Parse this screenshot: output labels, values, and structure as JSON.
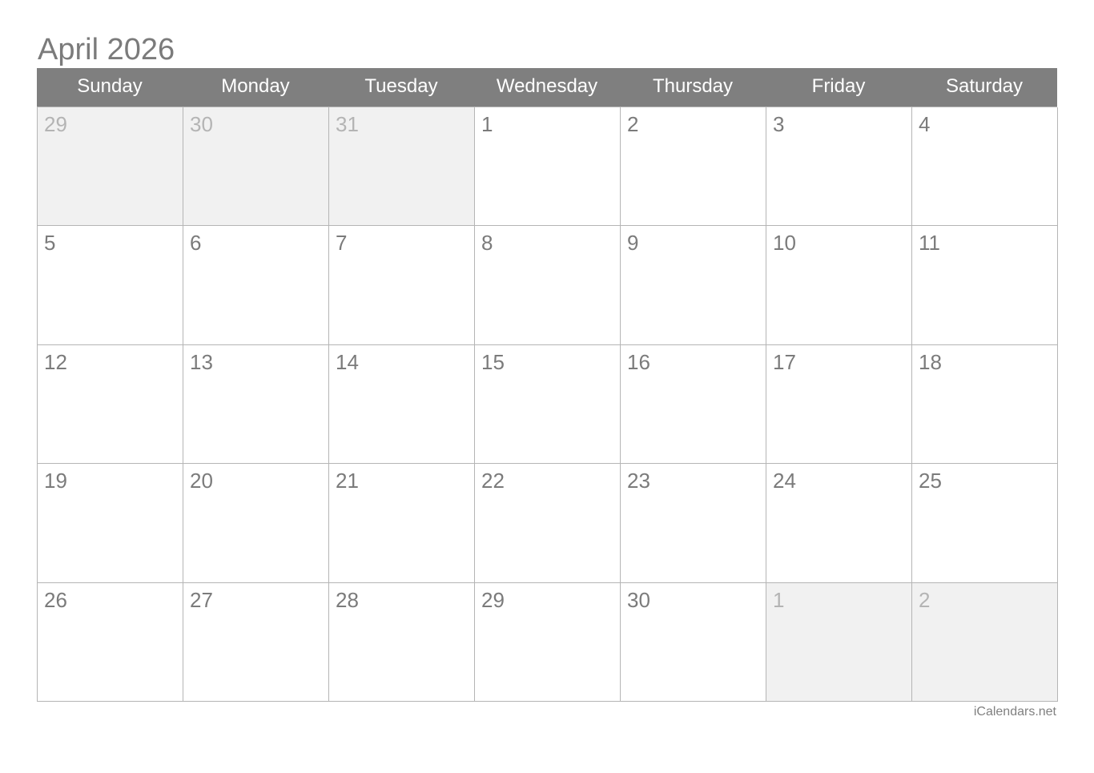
{
  "title": "April 2026",
  "weekdays": [
    "Sunday",
    "Monday",
    "Tuesday",
    "Wednesday",
    "Thursday",
    "Friday",
    "Saturday"
  ],
  "weeks": [
    [
      {
        "d": "29",
        "other": true
      },
      {
        "d": "30",
        "other": true
      },
      {
        "d": "31",
        "other": true
      },
      {
        "d": "1"
      },
      {
        "d": "2"
      },
      {
        "d": "3"
      },
      {
        "d": "4"
      }
    ],
    [
      {
        "d": "5"
      },
      {
        "d": "6"
      },
      {
        "d": "7"
      },
      {
        "d": "8"
      },
      {
        "d": "9"
      },
      {
        "d": "10"
      },
      {
        "d": "11"
      }
    ],
    [
      {
        "d": "12"
      },
      {
        "d": "13"
      },
      {
        "d": "14"
      },
      {
        "d": "15"
      },
      {
        "d": "16"
      },
      {
        "d": "17"
      },
      {
        "d": "18"
      }
    ],
    [
      {
        "d": "19"
      },
      {
        "d": "20"
      },
      {
        "d": "21"
      },
      {
        "d": "22"
      },
      {
        "d": "23"
      },
      {
        "d": "24"
      },
      {
        "d": "25"
      }
    ],
    [
      {
        "d": "26"
      },
      {
        "d": "27"
      },
      {
        "d": "28"
      },
      {
        "d": "29"
      },
      {
        "d": "30"
      },
      {
        "d": "1",
        "other": true
      },
      {
        "d": "2",
        "other": true
      }
    ]
  ],
  "footer": "iCalendars.net"
}
